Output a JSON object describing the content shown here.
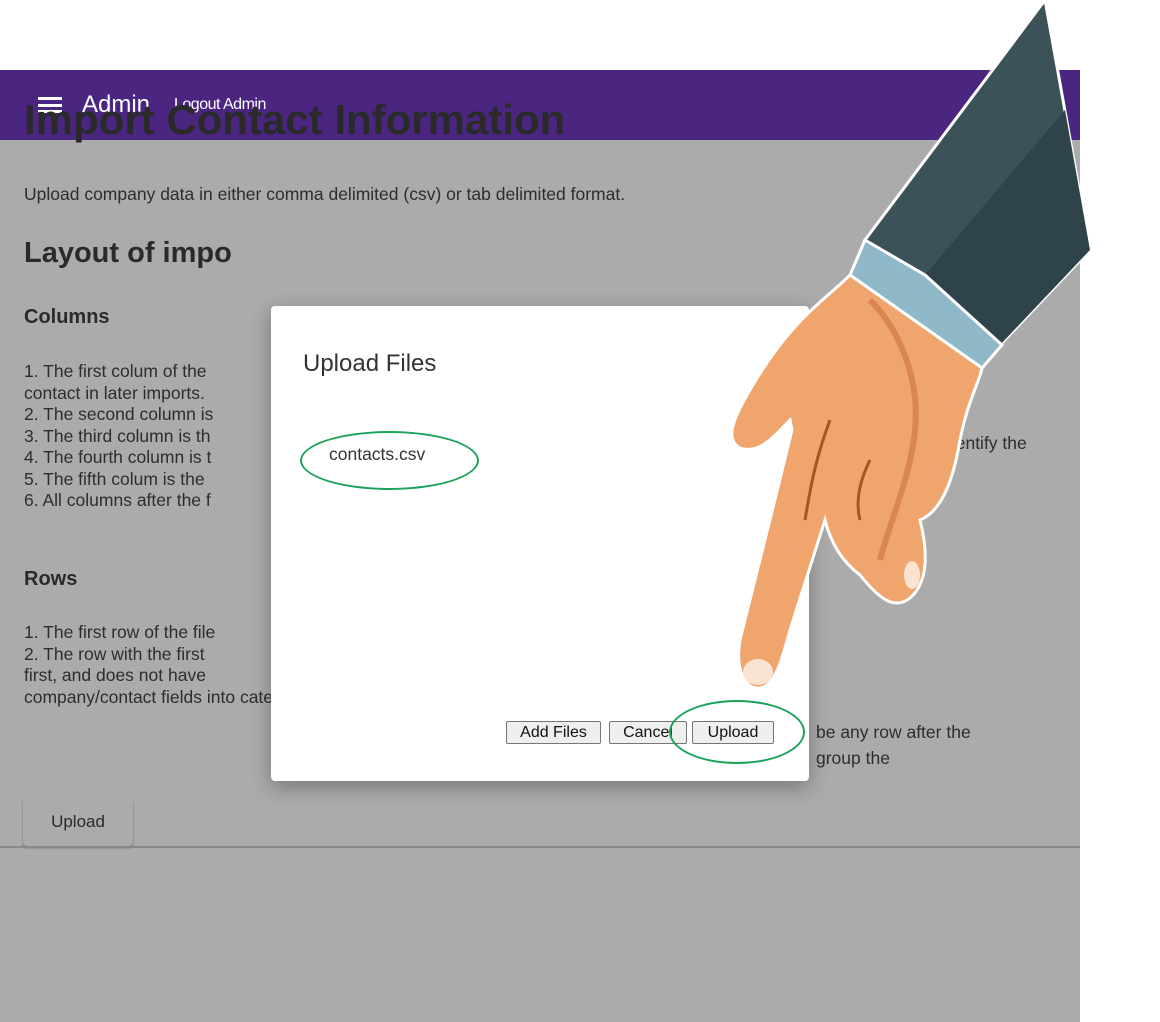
{
  "appbar": {
    "menu_icon": "hamburger-menu-icon",
    "title": "Admin",
    "logout_label": "Logout Admin",
    "color": "#4a2680"
  },
  "page": {
    "title": "Import Contact Information",
    "intro": "Upload company data in either comma delimited (csv) or tab delimited format.",
    "layout_heading": "Layout of impo",
    "columns_heading": "Columns",
    "column_lines": [
      "1. The first colum of the",
      "contact in later imports.",
      "2. The second column is",
      "3. The third column is th",
      "4. The fourth column is t",
      "5. The fifth colum is the",
      "6. All columns after the f"
    ],
    "column_right_text": "dentify the",
    "rows_heading": "Rows",
    "row_lines": [
      "1. The first row of the file",
      "2. The row with the first",
      "first, and does not have",
      "company/contact fields into categories."
    ],
    "row_right_lines": [
      "be any row after the",
      "group the"
    ],
    "upload_button": "Upload"
  },
  "dialog": {
    "title": "Upload Files",
    "file_name": "contacts.csv",
    "add_files_label": "Add Files",
    "cancel_label": "Cancel",
    "upload_label": "Upload"
  },
  "annotations": {
    "highlight_color": "#1aa35a",
    "pointer": "pointing-hand-illustration"
  }
}
